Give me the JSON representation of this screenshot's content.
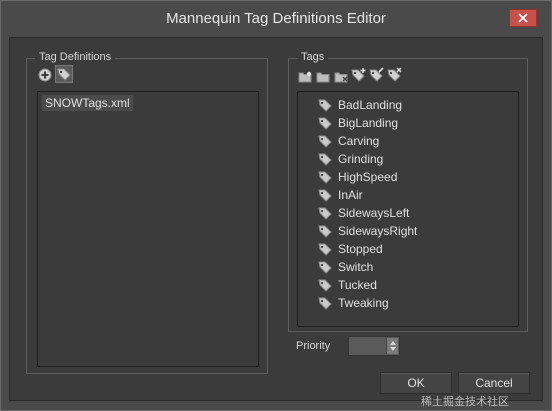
{
  "window": {
    "title": "Mannequin Tag Definitions Editor"
  },
  "tag_definitions": {
    "group_title": "Tag Definitions",
    "toolbar": [
      {
        "icon": "add-circle-icon"
      },
      {
        "icon": "tag-icon"
      }
    ],
    "files": [
      "SNOWTags.xml"
    ]
  },
  "tags": {
    "group_title": "Tags",
    "toolbar": [
      {
        "icon": "new-folder-icon"
      },
      {
        "icon": "folder-icon"
      },
      {
        "icon": "folder-remove-icon"
      },
      {
        "icon": "tag-add-icon"
      },
      {
        "icon": "tag-edit-icon"
      },
      {
        "icon": "tag-remove-icon"
      }
    ],
    "items": [
      "BadLanding",
      "BigLanding",
      "Carving",
      "Grinding",
      "HighSpeed",
      "InAir",
      "SidewaysLeft",
      "SidewaysRight",
      "Stopped",
      "Switch",
      "Tucked",
      "Tweaking"
    ]
  },
  "priority": {
    "label": "Priority"
  },
  "buttons": {
    "ok": "OK",
    "cancel": "Cancel"
  },
  "watermark": "稀土掘金技术社区",
  "colors": {
    "background": "#3b3b3b",
    "close_button": "#c7504b",
    "tag_icon": "#c9c9c9"
  }
}
